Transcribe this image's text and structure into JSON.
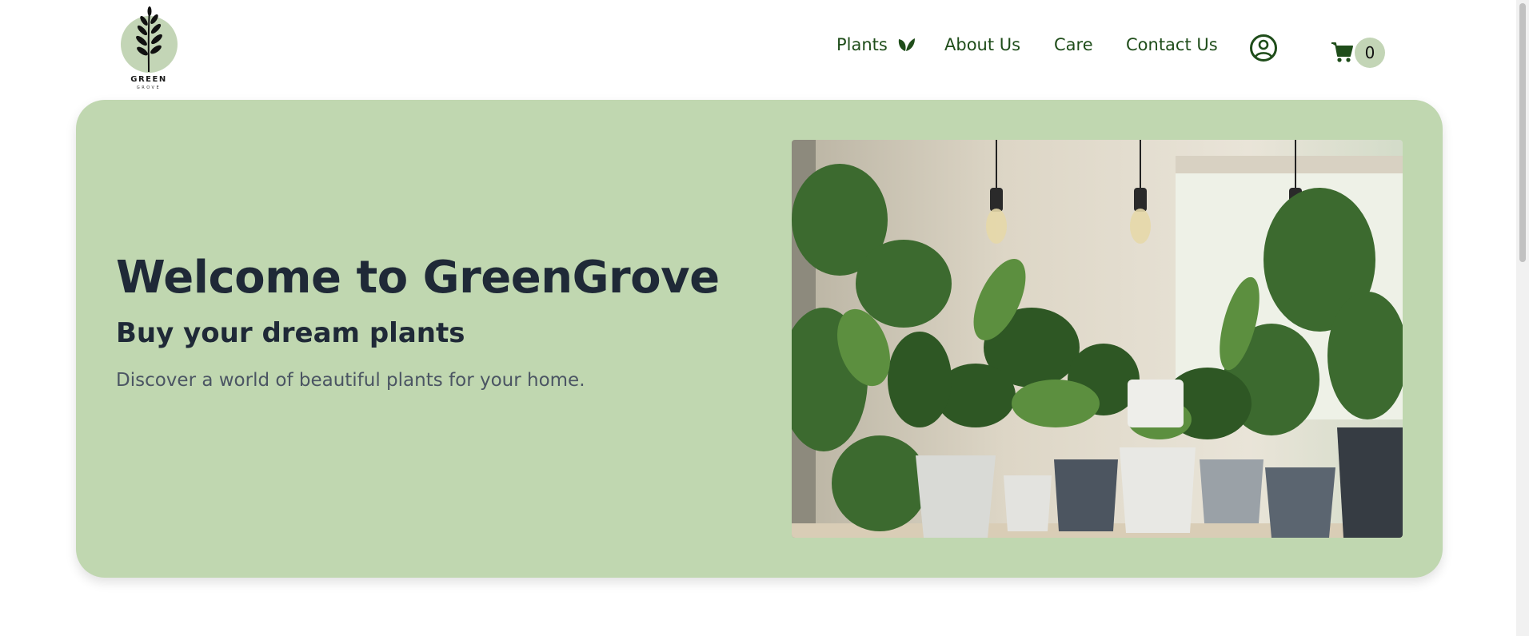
{
  "header": {
    "logo": {
      "text": "GREEN",
      "subtext": "GROVE"
    },
    "nav": {
      "plants": "Plants",
      "about": "About Us",
      "care": "Care",
      "contact": "Contact Us"
    },
    "cart_count": "0"
  },
  "hero": {
    "title": "Welcome to GreenGrove",
    "subtitle": "Buy your dream plants",
    "description": "Discover a world of beautiful plants for your home."
  },
  "icons": {
    "nav_plants": "leaf-icon",
    "account": "user-circle-icon",
    "cart": "shopping-cart-icon"
  },
  "colors": {
    "brand_green": "#c0d7b0",
    "nav_text": "#1f4d1a",
    "heading": "#1f2937",
    "body_text": "#4b5563"
  }
}
